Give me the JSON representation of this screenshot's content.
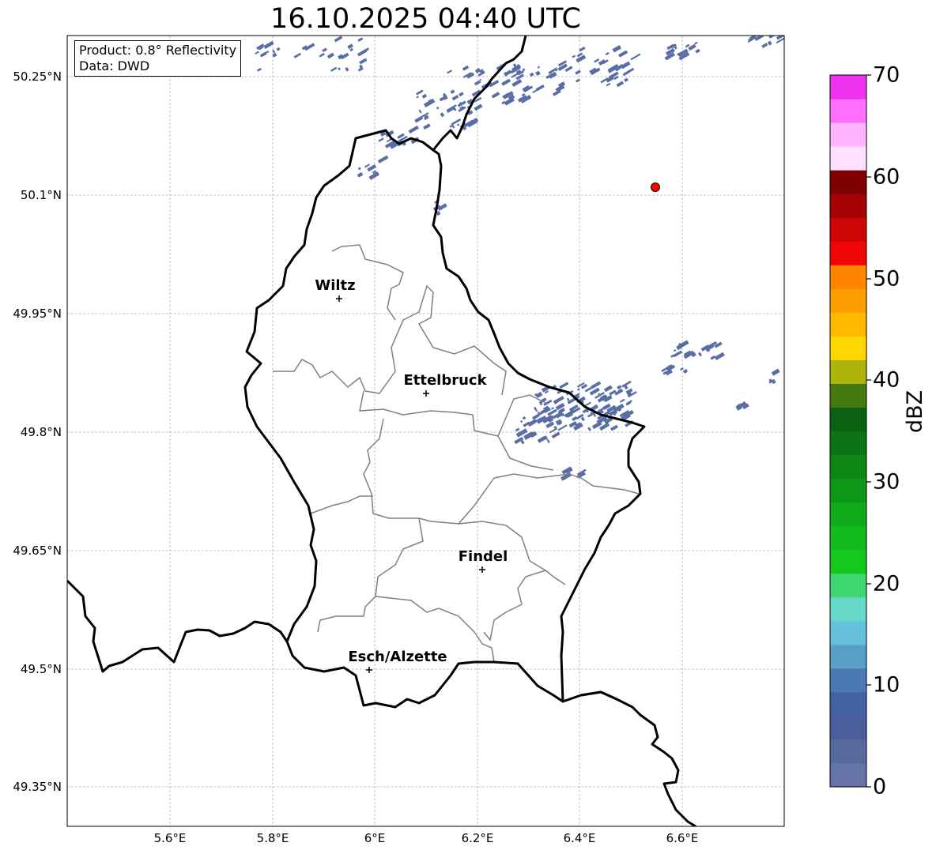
{
  "title": "16.10.2025 04:40 UTC",
  "info": {
    "product": "Product: 0.8° Reflectivity",
    "data": "Data: DWD"
  },
  "lat_ticks": [
    "50.25°N",
    "50.1°N",
    "49.95°N",
    "49.8°N",
    "49.65°N",
    "49.5°N",
    "49.35°N"
  ],
  "lon_ticks": [
    "5.6°E",
    "5.8°E",
    "6°E",
    "6.2°E",
    "6.4°E",
    "6.6°E"
  ],
  "cities": [
    {
      "name": "Wiltz"
    },
    {
      "name": "Ettelbruck"
    },
    {
      "name": "Findel"
    },
    {
      "name": "Esch/Alzette"
    }
  ],
  "colorbar": {
    "label": "dBZ",
    "ticks": [
      "0",
      "10",
      "20",
      "30",
      "40",
      "50",
      "60",
      "70"
    ],
    "colors": [
      "#6674a8",
      "#58699f",
      "#4a5e9e",
      "#4462a3",
      "#4a7ab4",
      "#59a0c8",
      "#66c2dc",
      "#66d9c8",
      "#40d672",
      "#14c81e",
      "#12bc1c",
      "#10aa1a",
      "#0f9818",
      "#0e8616",
      "#0c7414",
      "#0a6212",
      "#457a10",
      "#adb50c",
      "#ffd700",
      "#ffb900",
      "#ff9e00",
      "#ff8400",
      "#ef0606",
      "#cd0505",
      "#a50303",
      "#7d0101",
      "#ffe1ff",
      "#ffb4ff",
      "#ff6eff",
      "#f032f0"
    ]
  },
  "marker_color": "#ff0000",
  "echo_color": "#5a6ea6"
}
